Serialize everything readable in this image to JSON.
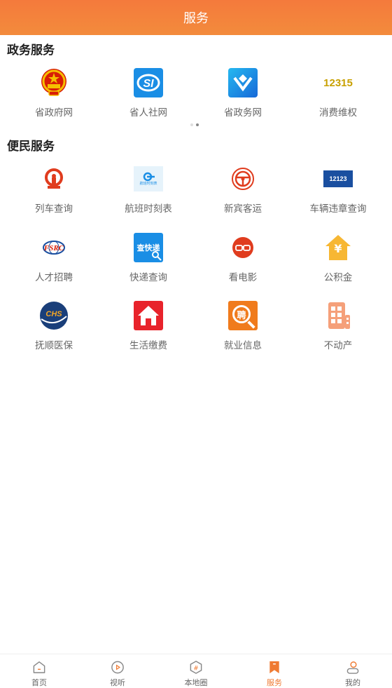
{
  "header": {
    "title": "服务"
  },
  "sections": {
    "gov": {
      "title": "政务服务",
      "items": [
        {
          "label": "省政府网",
          "icon": "national-emblem-icon"
        },
        {
          "label": "省人社网",
          "icon": "si-logo-icon"
        },
        {
          "label": "省政务网",
          "icon": "gov-service-logo-icon"
        },
        {
          "label": "消费维权",
          "icon": "12315-logo-icon",
          "logo_text": "12315"
        }
      ]
    },
    "citizen": {
      "title": "便民服务",
      "items": [
        {
          "label": "列车查询",
          "icon": "railway-logo-icon"
        },
        {
          "label": "航班时刻表",
          "icon": "flight-schedule-icon",
          "logo_text": "航班时刻表"
        },
        {
          "label": "新宾客运",
          "icon": "bus-transport-logo-icon"
        },
        {
          "label": "车辆违章查询",
          "icon": "12123-logo-icon",
          "logo_text": "12123"
        },
        {
          "label": "人才招聘",
          "icon": "talent-logo-icon",
          "logo_text": "FSRC"
        },
        {
          "label": "快递查询",
          "icon": "express-query-icon",
          "logo_text": "查快递"
        },
        {
          "label": "看电影",
          "icon": "movie-glasses-icon"
        },
        {
          "label": "公积金",
          "icon": "housing-fund-icon",
          "logo_text": "¥"
        },
        {
          "label": "抚顺医保",
          "icon": "chs-medical-insurance-icon",
          "logo_text": "CHS"
        },
        {
          "label": "生活缴费",
          "icon": "home-bill-icon"
        },
        {
          "label": "就业信息",
          "icon": "employment-info-icon",
          "logo_text": "聘"
        },
        {
          "label": "不动产",
          "icon": "real-estate-icon"
        }
      ]
    }
  },
  "tabbar": {
    "items": [
      {
        "label": "首页",
        "icon": "home-icon"
      },
      {
        "label": "视听",
        "icon": "play-icon"
      },
      {
        "label": "本地圈",
        "icon": "hashtag-hexagon-icon"
      },
      {
        "label": "服务",
        "icon": "bookmark-icon",
        "active": true
      },
      {
        "label": "我的",
        "icon": "user-icon"
      }
    ]
  },
  "colors": {
    "accent": "#ef7a32",
    "header_top": "#f47a3c",
    "header_bottom": "#f38b3c"
  }
}
